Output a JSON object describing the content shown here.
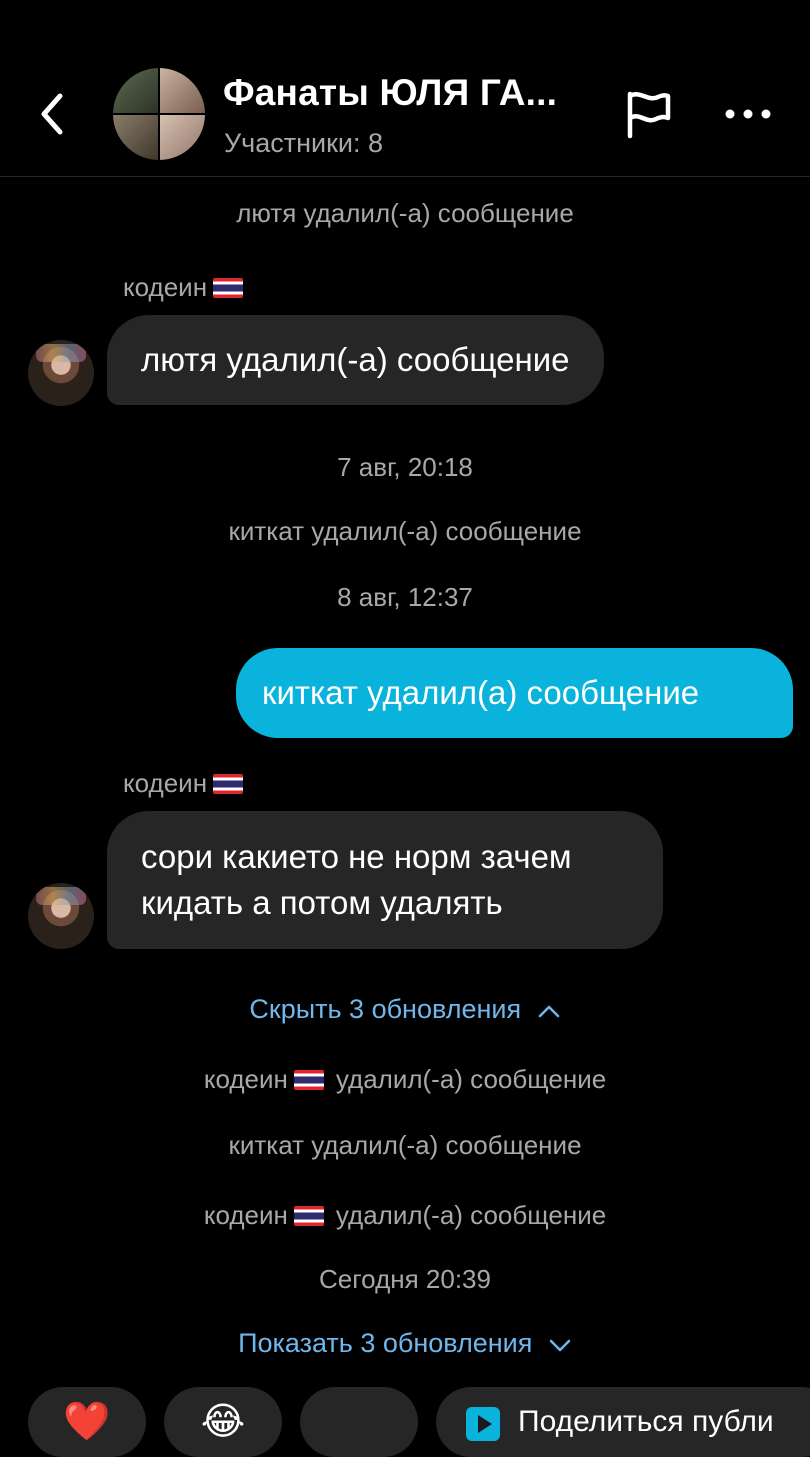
{
  "header": {
    "title": "Фанаты ЮЛЯ ГА...",
    "subtitle": "Участники: 8"
  },
  "messages": {
    "sys1": "лютя удалил(-а) сообщение",
    "sender1": "кодеин",
    "bubble1": "лютя удалил(-а) сообщение",
    "time1": "7 авг, 20:18",
    "sys2": "киткат удалил(-а) сообщение",
    "time2": "8 авг, 12:37",
    "outgoing": "киткат удалил(а) сообщение",
    "sender2": "кодеин",
    "bubble2_line1": "сори какието не норм зачем",
    "bubble2_line2": "кидать а потом удалять",
    "hide_updates": "Скрыть 3 обновления",
    "upd1_sender": "кодеин",
    "upd1_text": "удалил(-а) сообщение",
    "upd2": "киткат удалил(-а) сообщение",
    "upd3_sender": "кодеин",
    "upd3_text": "удалил(-а) сообщение",
    "time3": "Сегодня 20:39",
    "show_updates": "Показать 3 обновления"
  },
  "reactions": {
    "heart": "❤️",
    "laugh": "😂",
    "share_label": "Поделиться публи"
  },
  "icons": [
    "back-arrow-icon",
    "flag-icon",
    "more-icon",
    "thai-flag-icon",
    "chevron-up-icon",
    "chevron-down-icon",
    "play-icon"
  ]
}
